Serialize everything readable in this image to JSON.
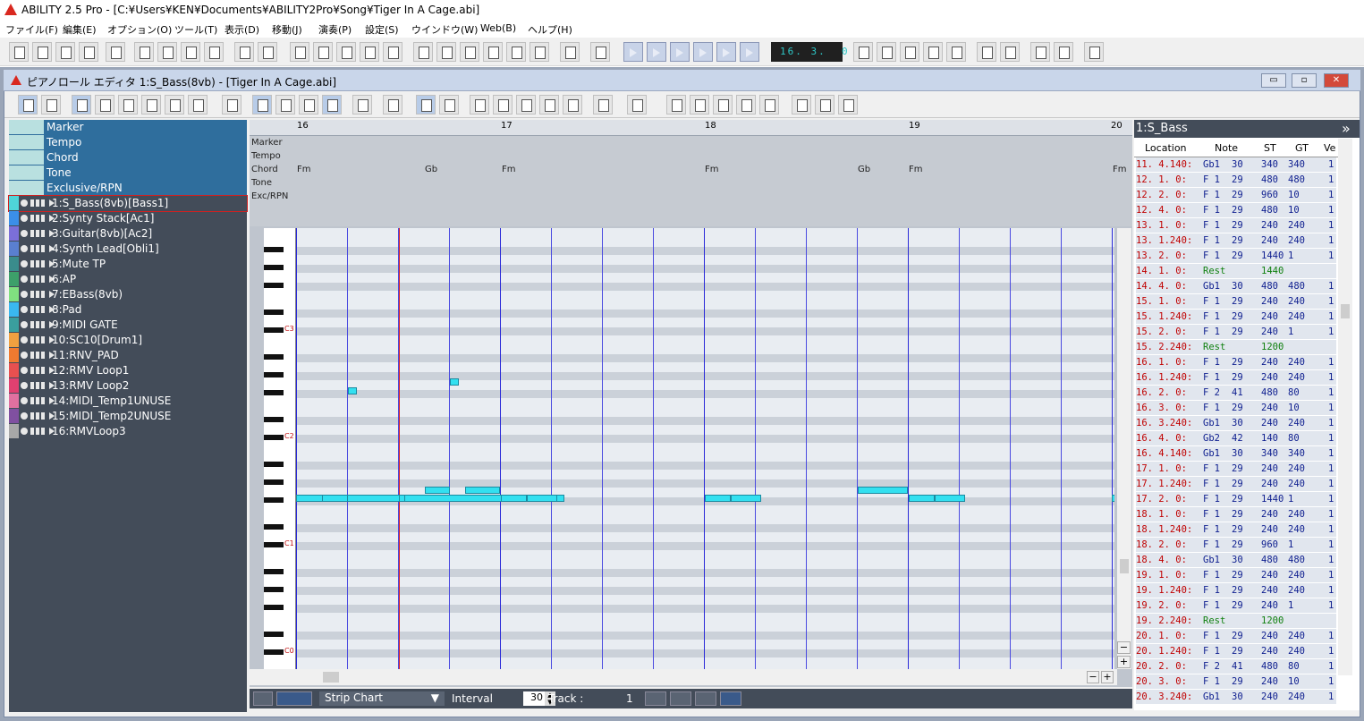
{
  "window": {
    "title": "ABILITY 2.5 Pro - [C:¥Users¥KEN¥Documents¥ABILITY2Pro¥Song¥Tiger In A Cage.abi]"
  },
  "menu": [
    "ファイル(F)",
    "編集(E)",
    "オプション(O)",
    "ツール(T)",
    "表示(D)",
    "移動(J)",
    "演奏(P)",
    "設定(S)",
    "ウインドウ(W)",
    "Web(B)",
    "ヘルプ(H)"
  ],
  "transport": {
    "position": "16. 3.  0"
  },
  "piano": {
    "title": "ピアノロール エディタ   1:S_Bass(8vb) - [Tiger In A Cage.abi]",
    "win_buttons": [
      "▭",
      "▫",
      "✕"
    ]
  },
  "meta_tracks": [
    "Marker",
    "Tempo",
    "Chord",
    "Tone",
    "Exclusive/RPN"
  ],
  "tracks": [
    {
      "label": "1:S_Bass(8vb)[Bass1]",
      "color": "#4fd4d8"
    },
    {
      "label": "2:Synty Stack[Ac1]",
      "color": "#3b8fe8"
    },
    {
      "label": "3:Guitar(8vb)[Ac2]",
      "color": "#7b6fd8"
    },
    {
      "label": "4:Synth Lead[Obli1]",
      "color": "#5a7fd0"
    },
    {
      "label": "5:Mute TP",
      "color": "#3a8c8c"
    },
    {
      "label": "6:AP",
      "color": "#3da06a"
    },
    {
      "label": "7:EBass(8vb)",
      "color": "#80e080"
    },
    {
      "label": "8:Pad",
      "color": "#3ab8f0"
    },
    {
      "label": "9:MIDI GATE",
      "color": "#3a9e9e"
    },
    {
      "label": "10:SC10[Drum1]",
      "color": "#f0a040"
    },
    {
      "label": "11:RNV_PAD",
      "color": "#f07a30"
    },
    {
      "label": "12:RMV Loop1",
      "color": "#e85050"
    },
    {
      "label": "13:RMV Loop2",
      "color": "#e04070"
    },
    {
      "label": "14:MIDI_Temp1UNUSE",
      "color": "#e070a0"
    },
    {
      "label": "15:MIDI_Temp2UNUSE",
      "color": "#8050a0"
    },
    {
      "label": "16:RMVLoop3",
      "color": "#a8a8a8"
    }
  ],
  "ruler": [
    "16",
    "17",
    "18",
    "19",
    "20"
  ],
  "meta_labels": [
    "Marker",
    "Tempo",
    "Chord",
    "Tone",
    "Exc/RPN"
  ],
  "chords": [
    "Fm",
    "Gb",
    "Fm",
    "Fm",
    "Gb",
    "Fm",
    "Fm"
  ],
  "octave_labels": [
    "C3",
    "C2",
    "C1",
    "C0"
  ],
  "strip": {
    "mode": "Strip Chart",
    "interval_label": "Interval",
    "interval": "30",
    "track_label": "Track  :",
    "track": "1"
  },
  "eventlist": {
    "title": "1:S_Bass",
    "nav": "»",
    "cols": [
      "Location",
      "Note",
      "ST",
      "GT",
      "Ve"
    ],
    "rows": [
      [
        "11. 4.140:",
        "Gb1",
        "30",
        "340",
        "340",
        "1"
      ],
      [
        "12. 1.  0:",
        "F 1",
        "29",
        "480",
        "480",
        "1"
      ],
      [
        "12. 2.  0:",
        "F 1",
        "29",
        "960",
        "10",
        "1"
      ],
      [
        "12. 4.  0:",
        "F 1",
        "29",
        "480",
        "10",
        "1"
      ],
      [
        "13. 1.  0:",
        "F 1",
        "29",
        "240",
        "240",
        "1"
      ],
      [
        "13. 1.240:",
        "F 1",
        "29",
        "240",
        "240",
        "1"
      ],
      [
        "13. 2.  0:",
        "F 1",
        "29",
        "1440",
        "1",
        "1"
      ],
      [
        "14. 1.  0:",
        "Rest",
        "",
        "1440",
        "",
        ""
      ],
      [
        "14. 4.  0:",
        "Gb1",
        "30",
        "480",
        "480",
        "1"
      ],
      [
        "15. 1.  0:",
        "F 1",
        "29",
        "240",
        "240",
        "1"
      ],
      [
        "15. 1.240:",
        "F 1",
        "29",
        "240",
        "240",
        "1"
      ],
      [
        "15. 2.  0:",
        "F 1",
        "29",
        "240",
        "1",
        "1"
      ],
      [
        "15. 2.240:",
        "Rest",
        "",
        "1200",
        "",
        ""
      ],
      [
        "16. 1.  0:",
        "F 1",
        "29",
        "240",
        "240",
        "1"
      ],
      [
        "16. 1.240:",
        "F 1",
        "29",
        "240",
        "240",
        "1"
      ],
      [
        "16. 2.  0:",
        "F 2",
        "41",
        "480",
        "80",
        "1"
      ],
      [
        "16. 3.  0:",
        "F 1",
        "29",
        "240",
        "10",
        "1"
      ],
      [
        "16. 3.240:",
        "Gb1",
        "30",
        "240",
        "240",
        "1"
      ],
      [
        "16. 4.  0:",
        "Gb2",
        "42",
        "140",
        "80",
        "1"
      ],
      [
        "16. 4.140:",
        "Gb1",
        "30",
        "340",
        "340",
        "1"
      ],
      [
        "17. 1.  0:",
        "F 1",
        "29",
        "240",
        "240",
        "1"
      ],
      [
        "17. 1.240:",
        "F 1",
        "29",
        "240",
        "240",
        "1"
      ],
      [
        "17. 2.  0:",
        "F 1",
        "29",
        "1440",
        "1",
        "1"
      ],
      [
        "18. 1.  0:",
        "F 1",
        "29",
        "240",
        "240",
        "1"
      ],
      [
        "18. 1.240:",
        "F 1",
        "29",
        "240",
        "240",
        "1"
      ],
      [
        "18. 2.  0:",
        "F 1",
        "29",
        "960",
        "1",
        "1"
      ],
      [
        "18. 4.  0:",
        "Gb1",
        "30",
        "480",
        "480",
        "1"
      ],
      [
        "19. 1.  0:",
        "F 1",
        "29",
        "240",
        "240",
        "1"
      ],
      [
        "19. 1.240:",
        "F 1",
        "29",
        "240",
        "240",
        "1"
      ],
      [
        "19. 2.  0:",
        "F 1",
        "29",
        "240",
        "1",
        "1"
      ],
      [
        "19. 2.240:",
        "Rest",
        "",
        "1200",
        "",
        ""
      ],
      [
        "20. 1.  0:",
        "F 1",
        "29",
        "240",
        "240",
        "1"
      ],
      [
        "20. 1.240:",
        "F 1",
        "29",
        "240",
        "240",
        "1"
      ],
      [
        "20. 2.  0:",
        "F 2",
        "41",
        "480",
        "80",
        "1"
      ],
      [
        "20. 3.  0:",
        "F 1",
        "29",
        "240",
        "10",
        "1"
      ],
      [
        "20. 3.240:",
        "Gb1",
        "30",
        "240",
        "240",
        "1"
      ]
    ]
  }
}
